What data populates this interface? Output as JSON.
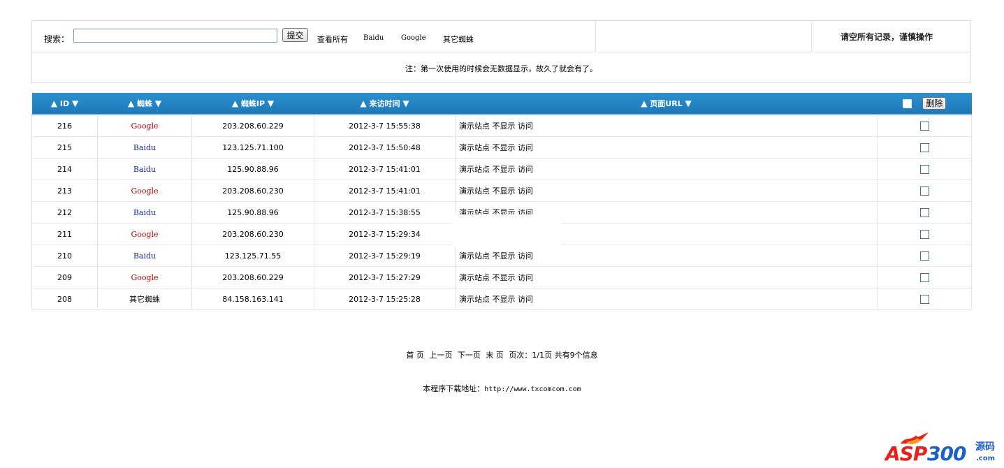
{
  "search": {
    "label": "搜索：",
    "value": "",
    "placeholder": "",
    "submit_label": "提交"
  },
  "filters": {
    "all": "查看所有",
    "baidu": "Baidu",
    "google": "Google",
    "other": "其它蜘蛛"
  },
  "clear_all": "请空所有记录，谨慎操作",
  "note": "注：第一次使用的时候会无数据显示，故久了就会有了。",
  "table": {
    "columns": [
      {
        "label": "ID"
      },
      {
        "label": "蜘蛛"
      },
      {
        "label": "蜘蛛IP"
      },
      {
        "label": "来访时间"
      },
      {
        "label": "页面URL"
      }
    ],
    "delete_label": "删除",
    "rows": [
      {
        "id": "216",
        "spider": "Google",
        "ip": "203.208.60.229",
        "time": "2012-3-7 15:55:38",
        "url": "演示站点 不显示 访问"
      },
      {
        "id": "215",
        "spider": "Baidu",
        "ip": "123.125.71.100",
        "time": "2012-3-7 15:50:48",
        "url": "演示站点 不显示 访问"
      },
      {
        "id": "214",
        "spider": "Baidu",
        "ip": "125.90.88.96",
        "time": "2012-3-7 15:41:01",
        "url": "演示站点 不显示 访问"
      },
      {
        "id": "213",
        "spider": "Google",
        "ip": "203.208.60.230",
        "time": "2012-3-7 15:41:01",
        "url": "演示站点 不显示 访问"
      },
      {
        "id": "212",
        "spider": "Baidu",
        "ip": "125.90.88.96",
        "time": "2012-3-7 15:38:55",
        "url": "演示站点 不显示 访问"
      },
      {
        "id": "211",
        "spider": "Google",
        "ip": "203.208.60.230",
        "time": "2012-3-7 15:29:34",
        "url": ""
      },
      {
        "id": "210",
        "spider": "Baidu",
        "ip": "123.125.71.55",
        "time": "2012-3-7 15:29:19",
        "url": "演示站点 不显示 访问"
      },
      {
        "id": "209",
        "spider": "Google",
        "ip": "203.208.60.229",
        "time": "2012-3-7 15:27:29",
        "url": "演示站点 不显示 访问"
      },
      {
        "id": "208",
        "spider": "其它蜘蛛",
        "ip": "84.158.163.141",
        "time": "2012-3-7 15:25:28",
        "url": "演示站点 不显示 访问"
      }
    ]
  },
  "pager": {
    "first": "首 页",
    "prev": "上一页",
    "next": "下一页",
    "last": "末 页",
    "info": "页次：1/1页 共有9个信息"
  },
  "footer": {
    "label": "本程序下载地址：",
    "url": "http://www.txcomcom.com"
  },
  "brand": {
    "asp": "ASP",
    "num": "300",
    "yuanma": "源码",
    "com": ".com"
  },
  "colors": {
    "header_bar": "#2b90cf",
    "google": "#c00000",
    "baidu": "#1a2a8a",
    "brand_red": "#e8211a",
    "brand_blue": "#1c5fc7"
  }
}
